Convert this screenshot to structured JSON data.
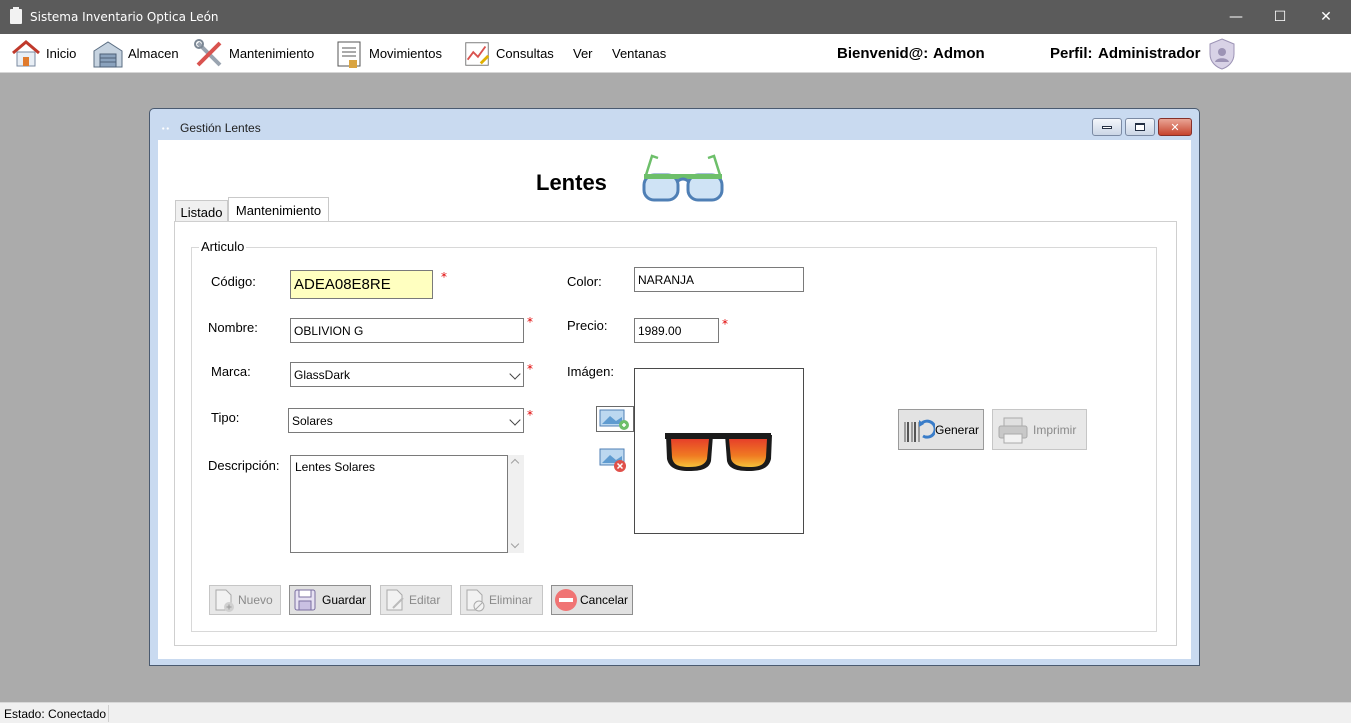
{
  "window": {
    "title": "Sistema Inventario Optica León",
    "minimize": "—",
    "maximize": "☐",
    "close": "✕"
  },
  "menu": {
    "items": [
      "Inicio",
      "Almacen",
      "Mantenimiento",
      "Movimientos",
      "Consultas",
      "Ver",
      "Ventanas"
    ],
    "welcome_label": "Bienvenid@:",
    "welcome_user": "Admon",
    "profile_label": "Perfil:",
    "profile_value": "Administrador"
  },
  "child": {
    "title": "Gestión Lentes",
    "heading": "Lentes",
    "tabs": [
      "Listado",
      "Mantenimiento"
    ],
    "active_tab": "Mantenimiento"
  },
  "form": {
    "group_title": "Articulo",
    "codigo_label": "Código:",
    "codigo_value": "ADEA08E8RE",
    "nombre_label": "Nombre:",
    "nombre_value": "OBLIVION G",
    "marca_label": "Marca:",
    "marca_value": "GlassDark",
    "tipo_label": "Tipo:",
    "tipo_value": "Solares",
    "descripcion_label": "Descripción:",
    "descripcion_value": "Lentes Solares",
    "color_label": "Color:",
    "color_value": "NARANJA",
    "precio_label": "Precio:",
    "precio_value": "1989.00",
    "imagen_label": "Imágen:",
    "required_mark": "*"
  },
  "buttons": {
    "generar": "Generar",
    "imprimir": "Imprimir",
    "nuevo": "Nuevo",
    "guardar": "Guardar",
    "editar": "Editar",
    "eliminar": "Eliminar",
    "cancelar": "Cancelar"
  },
  "status": {
    "text": "Estado: Conectado"
  },
  "colors": {
    "titlebar": "#5b5b5b",
    "codigo_bg": "#ffffc0",
    "required": "#e00000",
    "cancel_icon": "#f07474"
  }
}
